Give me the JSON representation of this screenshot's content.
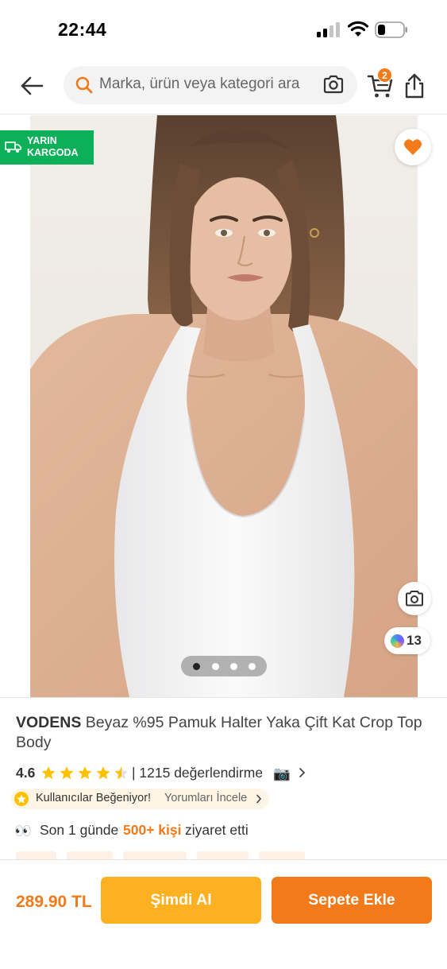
{
  "status_bar": {
    "time": "22:44"
  },
  "header": {
    "search_placeholder": "Marka, ürün veya kategori ara",
    "cart_count": "2"
  },
  "gallery": {
    "cargo_badge": "YARIN KARGODA",
    "ai_count": "13",
    "active_page": 1,
    "page_count": 4
  },
  "product": {
    "brand": "VODENS",
    "title": "Beyaz %95 Pamuk Halter Yaka Çift Kat Crop Top Body",
    "rating": "4.6",
    "rating_stars": 4.5,
    "review_text": "| 1215 değerlendirme",
    "camera_emoji": "📷",
    "liked_label": "Kullanıcılar Beğeniyor!",
    "liked_link": "Yorumları İncele",
    "visit_eyes": "👀",
    "visit_prefix": "Son 1 günde",
    "visit_highlight": "500+ kişi",
    "visit_suffix": "ziyaret etti"
  },
  "bottom_bar": {
    "price": "289.90 TL",
    "buy_now_label": "Şimdi Al",
    "add_to_cart_label": "Sepete Ekle"
  },
  "colors": {
    "brand_orange": "#f27a1a",
    "buy_now_yellow": "#fdb022",
    "cargo_green": "#0bb058",
    "star_yellow": "#ffc000"
  }
}
